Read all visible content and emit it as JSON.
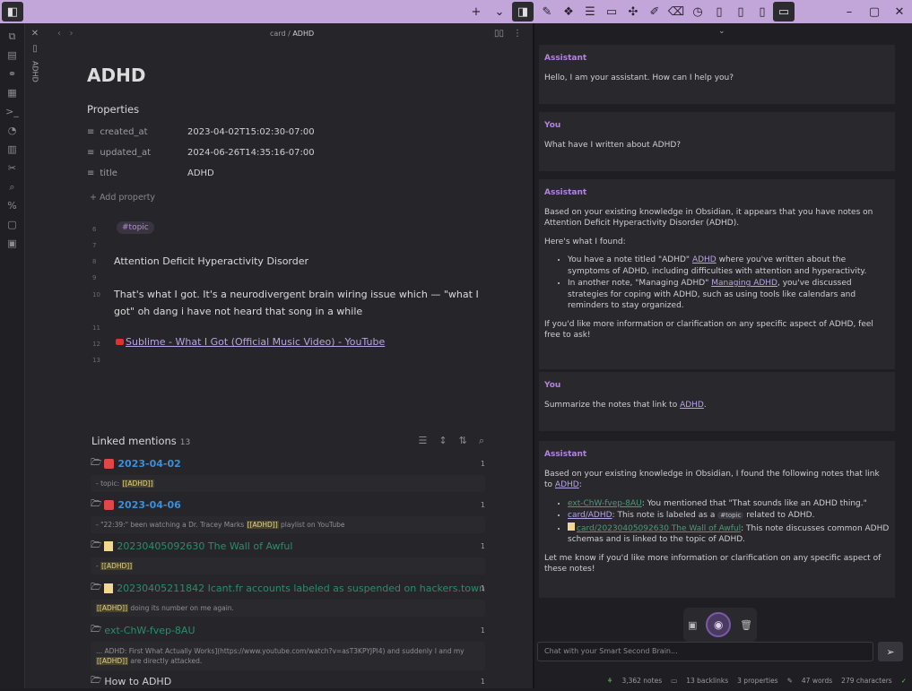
{
  "editor": {
    "breadcrumb_parent": "card",
    "breadcrumb_sep": " / ",
    "breadcrumb_current": "ADHD",
    "vertical_tab_label": "ADHD",
    "title": "ADHD",
    "properties_heading": "Properties",
    "properties": [
      {
        "key": "created_at",
        "value": "2023-04-02T15:02:30-07:00"
      },
      {
        "key": "updated_at",
        "value": "2024-06-26T14:35:16-07:00"
      },
      {
        "key": "title",
        "value": "ADHD"
      }
    ],
    "add_property": "+ Add property",
    "line_numbers": [
      "6",
      "7",
      "8",
      "9",
      "10",
      "11",
      "12",
      "13"
    ],
    "tag": "#topic",
    "line8": "Attention Deficit Hyperactivity Disorder",
    "line10": "That's what I got. It's a neurodivergent brain wiring issue which — \"what I got\" oh dang i have not heard that song in a while",
    "youtube_link": "Sublime - What I Got (Official Music Video) - YouTube"
  },
  "linked_mentions": {
    "heading": "Linked mentions",
    "count": "13",
    "items": [
      {
        "label": "2023-04-02",
        "count": "1",
        "snippet_pre": "- topic: ",
        "snippet_hl": "[[ADHD]]",
        "snippet_post": ""
      },
      {
        "label": "2023-04-06",
        "count": "1",
        "snippet_pre": "- \"22:39:\" been watching a Dr. Tracey Marks ",
        "snippet_hl": "[[ADHD]]",
        "snippet_post": " playlist on YouTube"
      },
      {
        "label": "20230405092630 The Wall of Awful",
        "count": "1",
        "snippet_pre": "- ",
        "snippet_hl": "[[ADHD]]",
        "snippet_post": ""
      },
      {
        "label": "20230405211842 Icant.fr accounts labeled as suspended on hackers.town",
        "count": "1",
        "snippet_pre": "",
        "snippet_hl": "[[ADHD]]",
        "snippet_post": " doing its number on me again."
      },
      {
        "label": "ext-ChW-fvep-8AU",
        "count": "1",
        "snippet_pre": "... ADHD: First What Actually Works](https://www.youtube.com/watch?v=asT3KPYJPl4) and suddenly I and my ",
        "snippet_hl": "[[ADHD]]",
        "snippet_post": " are directly attacked."
      },
      {
        "label": "How to ADHD",
        "count": "1"
      }
    ]
  },
  "chat": {
    "input_placeholder": "Chat with your Smart Second Brain...",
    "messages": [
      {
        "who": "Assistant",
        "text": "Hello, I am your assistant. How can I help you?"
      },
      {
        "who": "You",
        "text": "What have I written about ADHD?"
      },
      {
        "who": "Assistant",
        "p1": "Based on your existing knowledge in Obsidian, it appears that you have notes on Attention Deficit Hyperactivity Disorder (ADHD).",
        "p2": "Here's what I found:",
        "b1_pre": "You have a note titled \"ADHD\" ",
        "b1_link": "ADHD",
        "b1_post": " where you've written about the symptoms of ADHD, including difficulties with attention and hyperactivity.",
        "b2_pre": "In another note, \"Managing ADHD\" ",
        "b2_link": "Managing ADHD",
        "b2_post": ", you've discussed strategies for coping with ADHD, such as using tools like calendars and reminders to stay organized.",
        "p3": "If you'd like more information or clarification on any specific aspect of ADHD, feel free to ask!"
      },
      {
        "who": "You",
        "text_pre": "Summarize the notes that link to ",
        "text_link": "ADHD",
        "text_post": "."
      },
      {
        "who": "Assistant",
        "p1_pre": "Based on your existing knowledge in Obsidian, I found the following notes that link to ",
        "p1_link": "ADHD",
        "p1_post": ":",
        "b1_link": "ext-ChW-fvep-8AU",
        "b1_post": ": You mentioned that \"That sounds like an ADHD thing.\"",
        "b2_link": "card/ADHD",
        "b2_mid": ": This note is labeled as a ",
        "b2_tag": "#topic",
        "b2_post": " related to ADHD.",
        "b3_link": "card/20230405092630 The Wall of Awful",
        "b3_post": ": This note discusses common ADHD schemas and is linked to the topic of ADHD.",
        "p2": "Let me know if you'd like more information or clarification on any specific aspect of these notes!"
      }
    ]
  },
  "status": {
    "notes": "3,362 notes",
    "backlinks": "13 backlinks",
    "properties": "3 properties",
    "words": "47 words",
    "characters": "279 characters"
  }
}
